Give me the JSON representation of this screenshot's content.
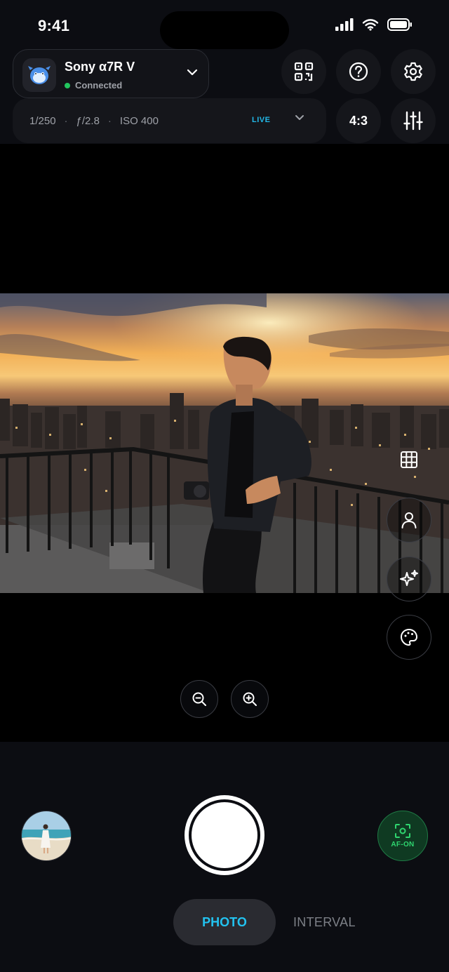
{
  "status_bar": {
    "time": "9:41"
  },
  "camera": {
    "name": "Sony α7R V",
    "status": "Connected"
  },
  "exposure": {
    "shutter": "1/250",
    "aperture": "ƒ/2.8",
    "iso": "ISO 400",
    "separator": "·",
    "live_label": "LIVE"
  },
  "aspect_ratio": "4:3",
  "icons": {
    "top_actions": [
      "qr-code-icon",
      "help-icon",
      "settings-icon",
      "sliders-icon"
    ],
    "side_tools": [
      "grid-icon",
      "person-icon",
      "sparkles-icon",
      "palette-icon"
    ],
    "zoom": [
      "zoom-out-icon",
      "zoom-in-icon"
    ],
    "af": "focus-frame-icon"
  },
  "af": {
    "label": "AF-ON"
  },
  "modes": {
    "active": "PHOTO",
    "other": "INTERVAL"
  },
  "colors": {
    "accent_cyan": "#22c3f0",
    "connected_green": "#22c55e",
    "af_green": "#2fd56f",
    "background": "#0c0d12"
  }
}
